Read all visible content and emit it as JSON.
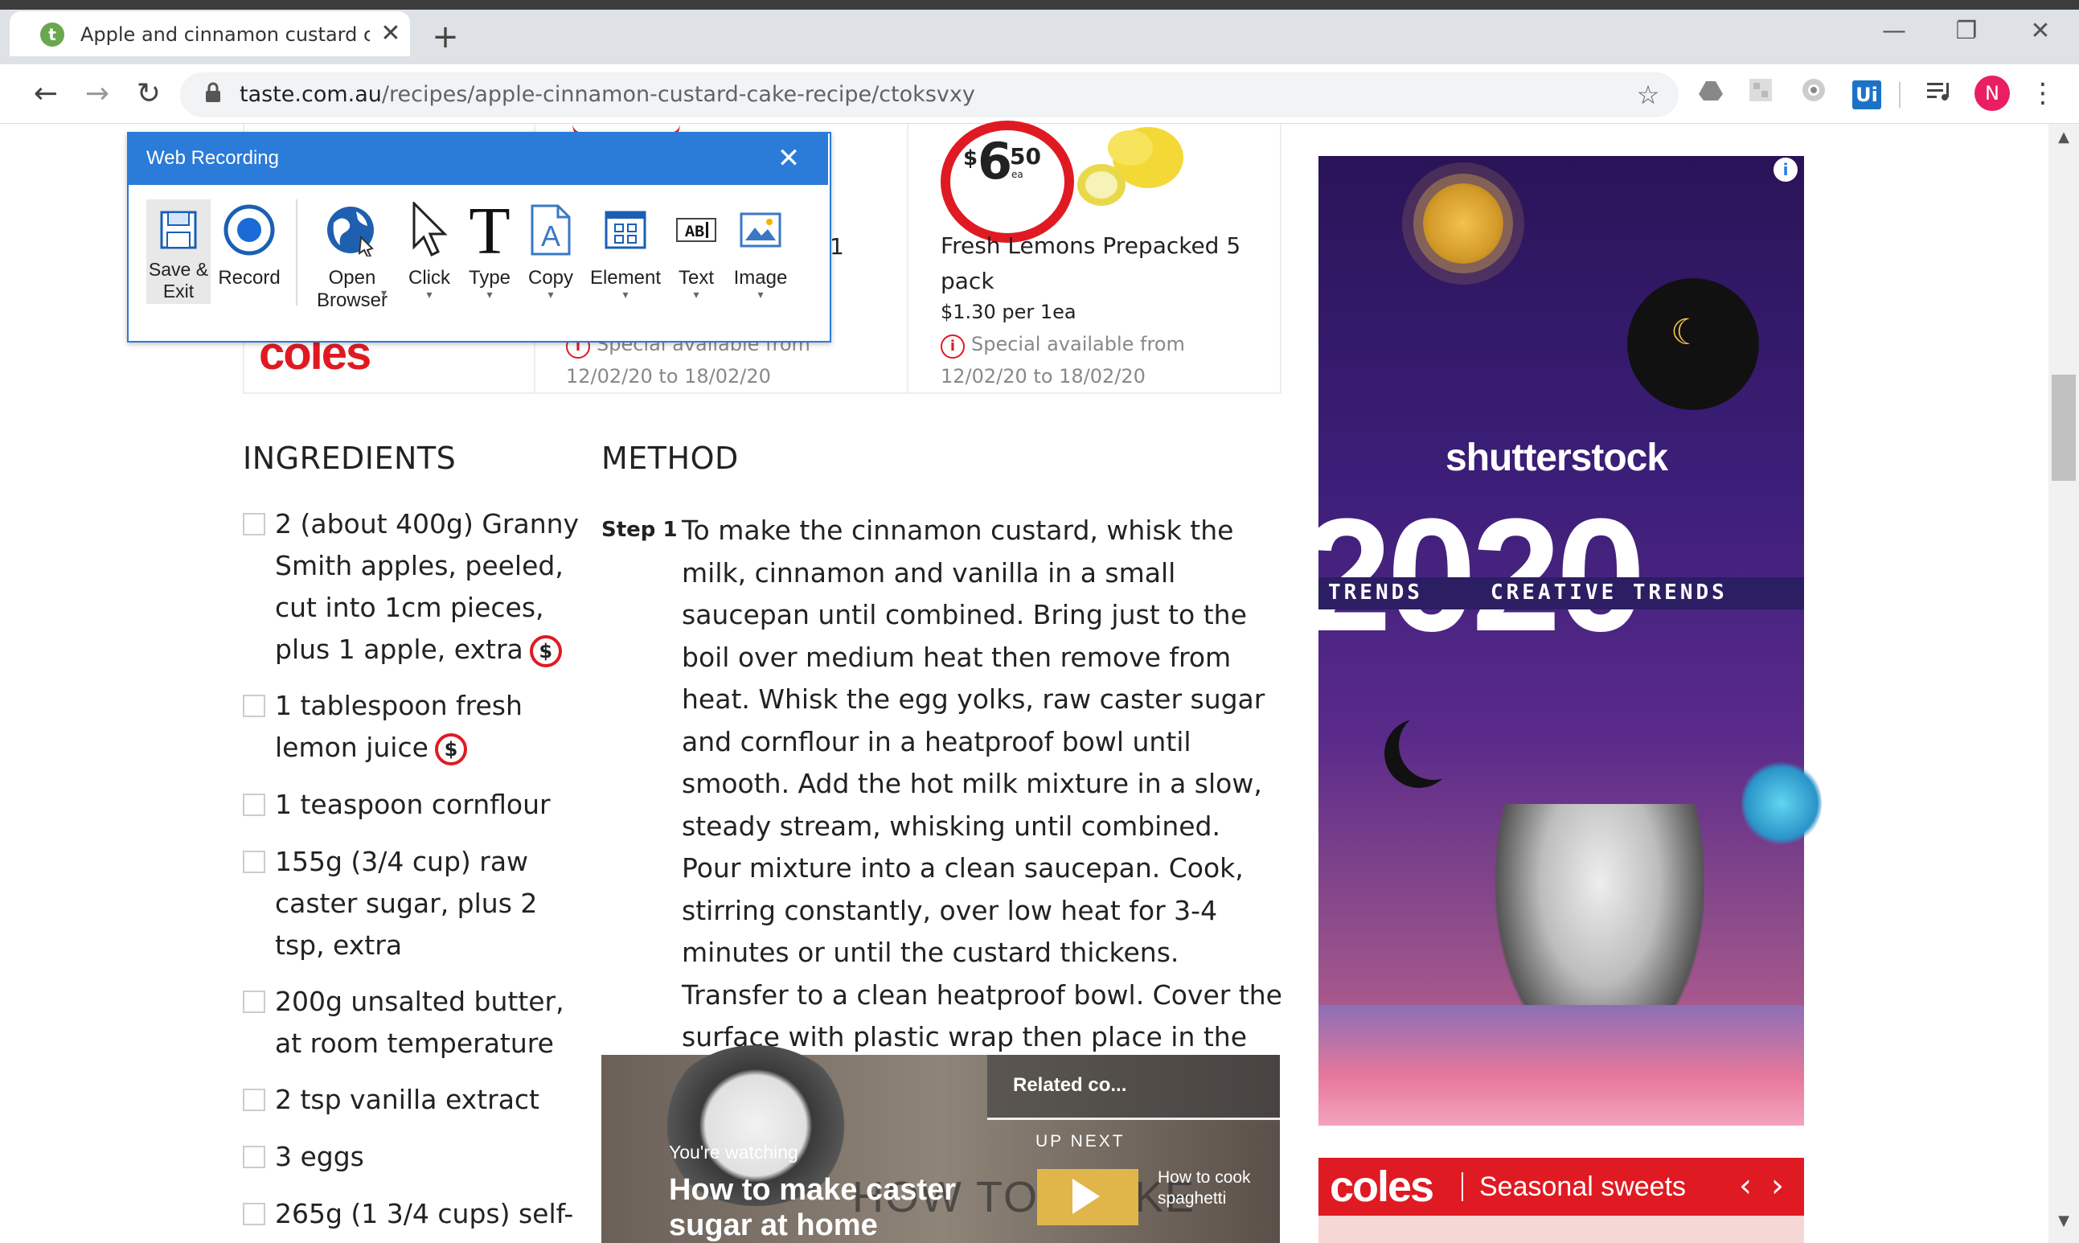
{
  "browser": {
    "tab_title": "Apple and cinnamon custard cak",
    "tab_favicon": "t",
    "tab_close": "✕",
    "new_tab": "+",
    "window_controls": {
      "minimize": "—",
      "restore": "❐",
      "close": "✕"
    },
    "nav": {
      "back": "←",
      "forward": "→",
      "reload": "↻"
    },
    "url_domain": "taste.com.au",
    "url_path": "/recipes/apple-cinnamon-custard-cake-recipe/ctoksvxy",
    "star": "☆",
    "extension_ui_label": "Ui",
    "avatar_letter": "N",
    "menu": "⋮",
    "icons": [
      "back-icon",
      "forward-icon",
      "reload-icon",
      "lock-icon",
      "star-icon",
      "drive-icon",
      "extension-icon",
      "camera-icon",
      "uipath-icon",
      "playlist-icon",
      "avatar-icon",
      "more-icon"
    ]
  },
  "product_strip": {
    "coles_logo": "coles",
    "partial_text": "1",
    "special_label": "Special available from",
    "dates": "12/02/20 to 18/02/20",
    "product": {
      "price_dollar": "$",
      "price_main": "6",
      "price_cents": "50",
      "price_unit": "ea",
      "name": "Fresh Lemons Prepacked 5 pack",
      "unit_price": "$1.30 per 1ea"
    },
    "accent_color": "#e01a22"
  },
  "web_recording": {
    "title": "Web Recording",
    "close": "✕",
    "buttons": {
      "save_exit": "Save & Exit",
      "record": "Record",
      "open_browser": "Open Browser",
      "click": "Click",
      "type": "Type",
      "copy": "Copy",
      "element": "Element",
      "text": "Text",
      "image": "Image"
    },
    "caret": "▾",
    "accent_color": "#2b7bd8"
  },
  "ingredients": {
    "title": "INGREDIENTS",
    "items": [
      "2 (about 400g) Granny Smith apples, peeled, cut into 1cm pieces, plus 1 apple, extra",
      "1 tablespoon fresh lemon juice",
      "1 teaspoon cornflour",
      "155g (3/4 cup) raw caster sugar, plus 2 tsp, extra",
      "200g unsalted butter, at room temperature",
      "2 tsp vanilla extract",
      "3 eggs",
      "265g (1 3/4 cups) self-"
    ],
    "dollar_badge": "$"
  },
  "method": {
    "title": "METHOD",
    "step_label": "Step 1",
    "step_text": "To make the cinnamon custard, whisk the milk, cinnamon and vanilla in a small saucepan until combined. Bring just to the boil over medium heat then remove from heat. Whisk the egg yolks, raw caster sugar and cornflour in a heatproof bowl until smooth. Add the hot milk mixture in a slow, steady stream, whisking until combined. Pour mixture into a clean saucepan. Cook, stirring constantly, over low heat for 3-4 minutes or until the custard thickens. Transfer to a clean heatproof bowl. Cover the surface with plastic wrap then place in the fridge to chill."
  },
  "video": {
    "related_label": "Related co...",
    "up_next": "UP NEXT",
    "next_title": "How to cook spaghetti",
    "watching": "You're watching",
    "title": "How to make caster sugar at home",
    "background_text": "HOW TO: MAKE"
  },
  "ad": {
    "brand": "shutterstock",
    "year": "2020",
    "trends_left": "TRENDS",
    "trends_main": "CREATIVE TRENDS",
    "info": "i"
  },
  "coles_banner": {
    "logo": "coles",
    "text": "Seasonal sweets",
    "prev": "‹",
    "next": "›"
  },
  "scrollbar": {
    "up": "▲",
    "down": "▼"
  }
}
